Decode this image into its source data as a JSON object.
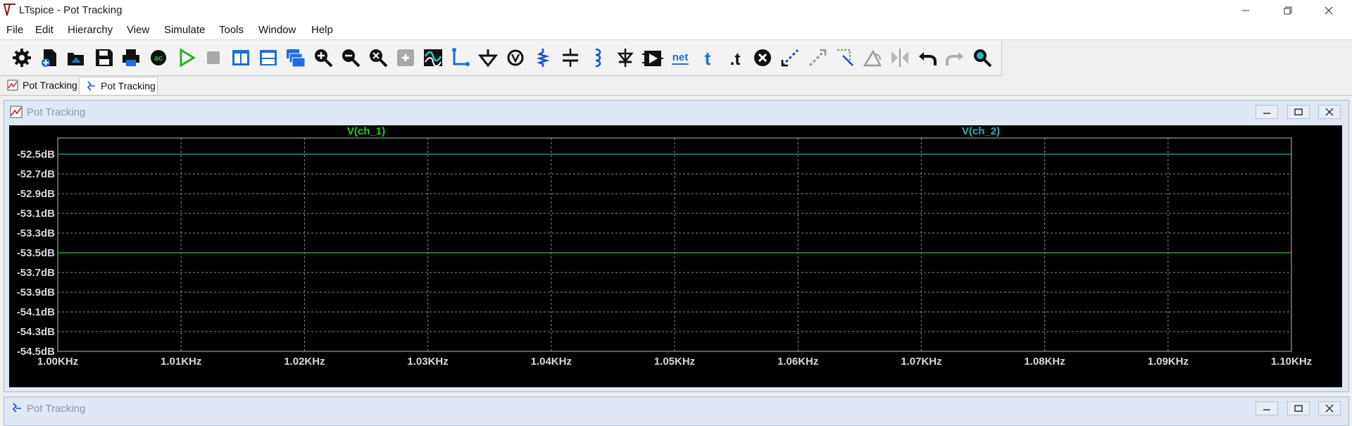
{
  "window": {
    "title": "LTspice - Pot Tracking"
  },
  "menu": {
    "items": [
      "File",
      "Edit",
      "Hierarchy",
      "View",
      "Simulate",
      "Tools",
      "Window",
      "Help"
    ]
  },
  "toolbar": {
    "tools": [
      "settings-icon",
      "new-schematic-icon",
      "open-icon",
      "save-icon",
      "print-icon",
      "ac-analysis-icon",
      "run-icon",
      "halt-icon",
      "tile-vertical-icon",
      "tile-horizontal-icon",
      "cascade-icon",
      "zoom-in-icon",
      "zoom-out-icon",
      "zoom-fit-icon",
      "zoom-extents-icon",
      "autorange-icon",
      "wire-icon",
      "ground-icon",
      "voltage-source-icon",
      "resistor-icon",
      "capacitor-icon",
      "inductor-icon",
      "diode-icon",
      "component-icon",
      "net-label-icon",
      "text-icon",
      "spice-directive-icon",
      "delete-icon",
      "duplicate-icon",
      "move-icon",
      "drag-icon",
      "rotate-icon",
      "mirror-icon",
      "undo-icon",
      "redo-icon",
      "find-icon"
    ],
    "net_label": "net",
    "text_label": "t",
    "directive_label": ".t"
  },
  "tabs": [
    {
      "label": "Pot Tracking",
      "icon": "waveform-icon",
      "active": false
    },
    {
      "label": "Pot Tracking",
      "icon": "schematic-icon",
      "active": true
    }
  ],
  "plot_window": {
    "title": "Pot Tracking"
  },
  "schematic_window": {
    "title": "Pot Tracking"
  },
  "colors": {
    "ch_1": "#1ed21e",
    "ch_2": "#19b4b4",
    "plot_bg": "#000000",
    "grid": "#8c8c8c",
    "axis_text": "#d8d8d8"
  },
  "chart_data": {
    "type": "line",
    "title": "",
    "xlabel": "",
    "ylabel": "",
    "x_unit": "KHz",
    "x": [
      1.0,
      1.1
    ],
    "xlim": [
      1.0,
      1.1
    ],
    "x_ticks": [
      "1.00KHz",
      "1.01KHz",
      "1.02KHz",
      "1.03KHz",
      "1.04KHz",
      "1.05KHz",
      "1.06KHz",
      "1.07KHz",
      "1.08KHz",
      "1.09KHz",
      "1.10KHz"
    ],
    "ylim": [
      -54.5,
      -52.3
    ],
    "y_ticks": [
      "-52.5dB",
      "-52.7dB",
      "-52.9dB",
      "-53.1dB",
      "-53.3dB",
      "-53.5dB",
      "-53.7dB",
      "-53.9dB",
      "-54.1dB",
      "-54.3dB",
      "-54.5dB"
    ],
    "y_tick_values": [
      -52.5,
      -52.7,
      -52.9,
      -53.1,
      -53.3,
      -53.5,
      -53.7,
      -53.9,
      -54.1,
      -54.3,
      -54.5
    ],
    "grid": true,
    "legend": "top",
    "series": [
      {
        "name": "V(ch_1)",
        "values": [
          -53.5,
          -53.5
        ]
      },
      {
        "name": "V(ch_2)",
        "values": [
          -52.5,
          -52.5
        ]
      }
    ]
  }
}
